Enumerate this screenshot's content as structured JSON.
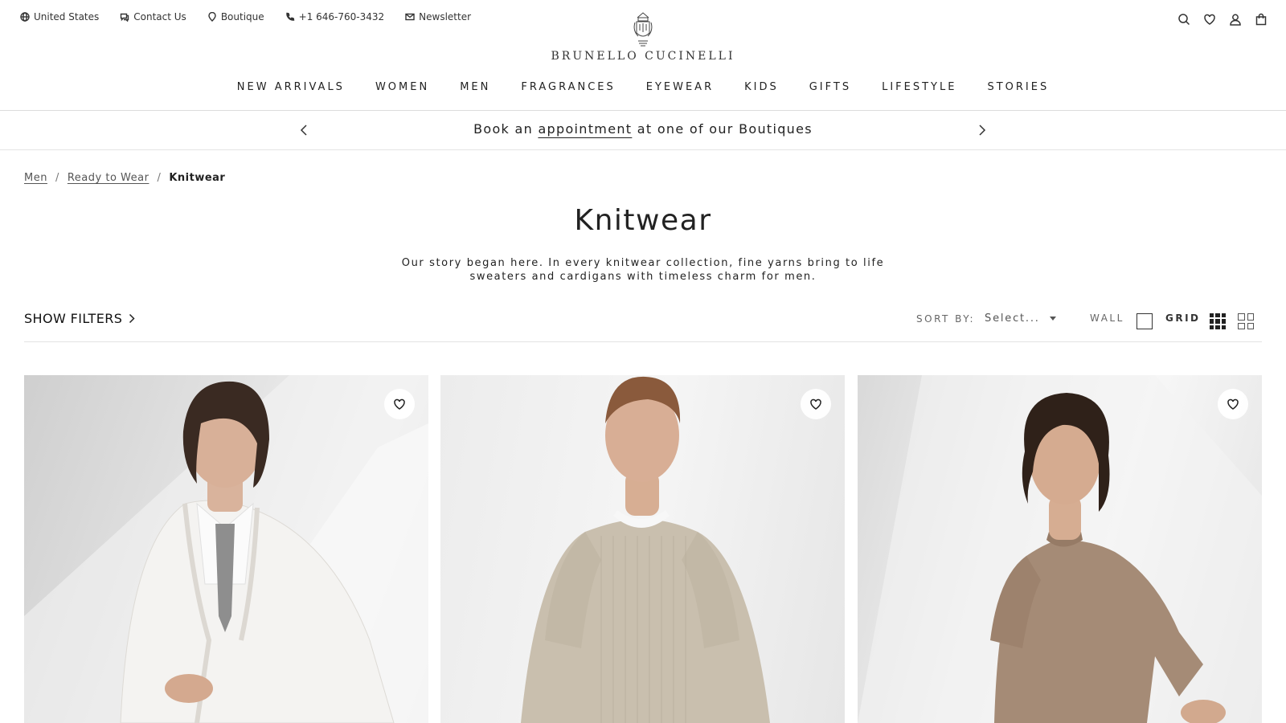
{
  "utility": {
    "country": "United States",
    "contact": "Contact Us",
    "boutique": "Boutique",
    "phone": "+1 646-760-3432",
    "newsletter": "Newsletter"
  },
  "brand": {
    "name": "BRUNELLO CUCINELLI"
  },
  "header_icons": [
    "search-icon",
    "heart-icon",
    "user-icon",
    "bag-icon"
  ],
  "nav": [
    "NEW ARRIVALS",
    "WOMEN",
    "MEN",
    "FRAGRANCES",
    "EYEWEAR",
    "KIDS",
    "GIFTS",
    "LIFESTYLE",
    "STORIES"
  ],
  "promo": {
    "prefix": "Book an",
    "link": "appointment",
    "suffix": "at one of our Boutiques"
  },
  "breadcrumb": [
    {
      "label": "Men",
      "link": true
    },
    {
      "label": "Ready to Wear",
      "link": true
    },
    {
      "label": "Knitwear",
      "link": false
    }
  ],
  "page": {
    "title": "Knitwear",
    "description": "Our story began here. In every knitwear collection, fine yarns bring to life sweaters and cardigans with timeless charm for men."
  },
  "toolbar": {
    "show_filters": "SHOW FILTERS",
    "sort_label": "SORT BY:",
    "sort_value": "Select...",
    "wall_label": "WALL",
    "grid_label": "GRID"
  },
  "products": [
    {
      "garment": "white shawl-collar cardigan",
      "color": "#f4f3f1"
    },
    {
      "garment": "beige ribbed short-sleeve sweater",
      "color": "#c9bfae"
    },
    {
      "garment": "taupe short-sleeve knit t-shirt",
      "color": "#a58b76"
    }
  ]
}
